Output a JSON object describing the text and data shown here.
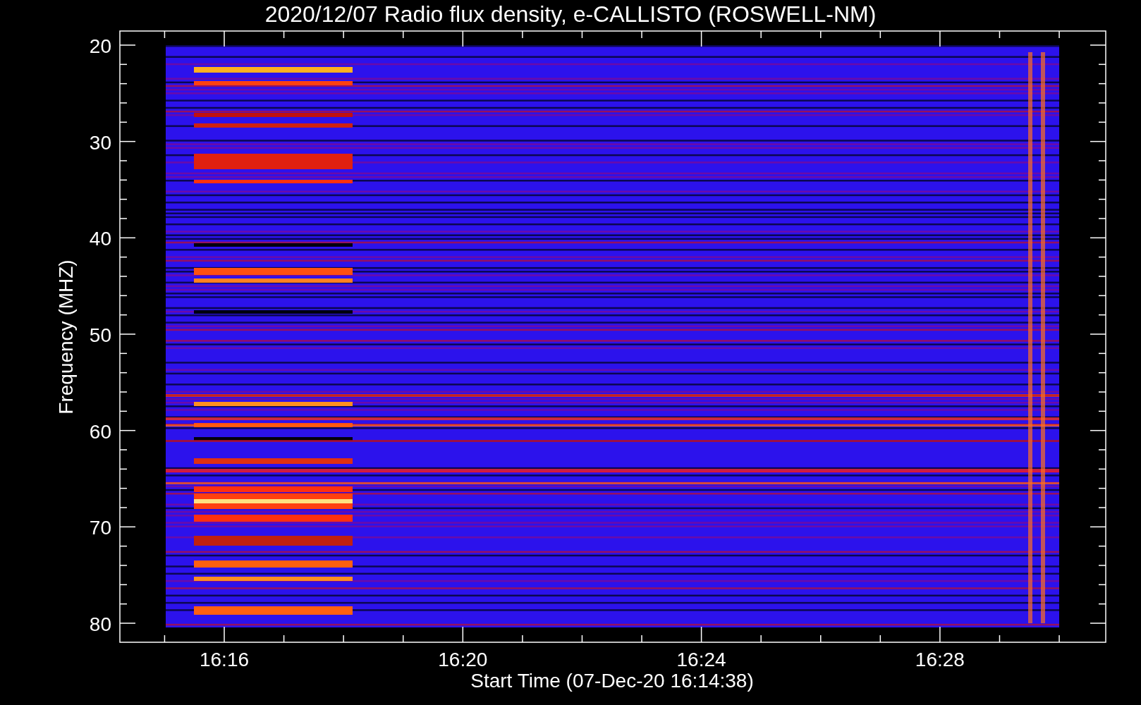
{
  "title": "2020/12/07  Radio flux density, e-CALLISTO (ROSWELL-NM)",
  "y_axis": {
    "label": "Frequency (MHZ)",
    "ticks": [
      "20",
      "30",
      "40",
      "50",
      "60",
      "70",
      "80"
    ]
  },
  "x_axis": {
    "label": "Start Time (07-Dec-20 16:14:38)",
    "ticks": [
      "16:16",
      "16:20",
      "16:24",
      "16:28"
    ]
  }
}
